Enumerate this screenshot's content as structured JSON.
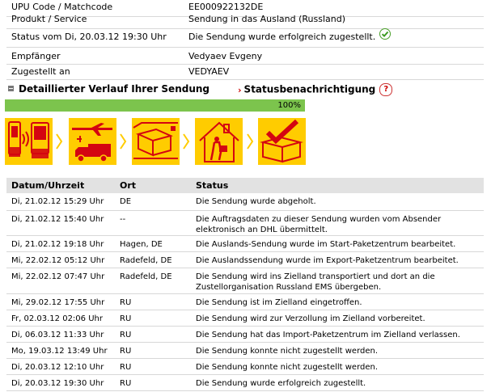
{
  "info": [
    {
      "label": "UPU Code / Matchcode",
      "value": "EE000922132DE"
    },
    {
      "label": "Produkt / Service",
      "value": "Sendung in das Ausland (Russland)"
    },
    {
      "label": "Status vom Di, 20.03.12 19:30 Uhr",
      "value": "Die Sendung wurde erfolgreich zugestellt."
    },
    {
      "label": "Empfänger",
      "value": "Vedyaev Evgeny"
    },
    {
      "label": "Zugestellt an",
      "value": "VEDYAEV"
    }
  ],
  "section": {
    "history_title": "Detaillierter Verlauf Ihrer Sendung",
    "notify_title": "Statusbenachrichtigung",
    "help_symbol": "?"
  },
  "progress": {
    "value": 1.0,
    "label": "100%",
    "color": "#7cc44d"
  },
  "steps": [
    {
      "icon": "package-scan-icon"
    },
    {
      "icon": "plane-truck-icon"
    },
    {
      "icon": "package-conveyor-icon"
    },
    {
      "icon": "delivery-house-icon"
    },
    {
      "icon": "package-checkmark-icon"
    }
  ],
  "colors": {
    "accent_yellow": "#ffcc00",
    "accent_red": "#d40511"
  },
  "table": {
    "headers": [
      "Datum/Uhrzeit",
      "Ort",
      "Status"
    ],
    "rows": [
      {
        "date": "Di, 21.02.12 15:29 Uhr",
        "place": "DE",
        "status": "Die Sendung wurde abgeholt."
      },
      {
        "date": "Di, 21.02.12 15:40 Uhr",
        "place": "--",
        "status": "Die Auftragsdaten zu dieser Sendung wurden vom Absender elektronisch an DHL übermittelt."
      },
      {
        "date": "Di, 21.02.12 19:18 Uhr",
        "place": "Hagen, DE",
        "status": "Die Auslands-Sendung wurde im Start-Paketzentrum bearbeitet."
      },
      {
        "date": "Mi, 22.02.12 05:12 Uhr",
        "place": "Radefeld, DE",
        "status": "Die Auslandssendung wurde im Export-Paketzentrum bearbeitet."
      },
      {
        "date": "Mi, 22.02.12 07:47 Uhr",
        "place": "Radefeld, DE",
        "status": "Die Sendung wird ins Zielland transportiert und dort an die Zustellorganisation Russland EMS übergeben."
      },
      {
        "date": "Mi, 29.02.12 17:55 Uhr",
        "place": "RU",
        "status": "Die Sendung ist im Zielland eingetroffen."
      },
      {
        "date": "Fr, 02.03.12 02:06 Uhr",
        "place": "RU",
        "status": "Die Sendung wird zur Verzollung im Zielland vorbereitet."
      },
      {
        "date": "Di, 06.03.12 11:33 Uhr",
        "place": "RU",
        "status": "Die Sendung hat das Import-Paketzentrum im Zielland verlassen."
      },
      {
        "date": "Mo, 19.03.12 13:49 Uhr",
        "place": "RU",
        "status": "Die Sendung konnte nicht zugestellt werden."
      },
      {
        "date": "Di, 20.03.12 12:10 Uhr",
        "place": "RU",
        "status": "Die Sendung konnte nicht zugestellt werden."
      },
      {
        "date": "Di, 20.03.12 19:30 Uhr",
        "place": "RU",
        "status": "Die Sendung wurde erfolgreich zugestellt."
      }
    ]
  }
}
